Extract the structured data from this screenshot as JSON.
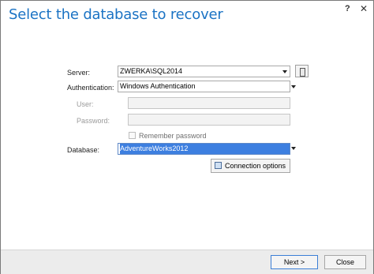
{
  "dialog": {
    "title": "Select the database to recover",
    "help_label": "?",
    "close_label": "✕"
  },
  "form": {
    "server_label": "Server:",
    "server_value": "ZWERKA\\SQL2014",
    "auth_label": "Authentication:",
    "auth_value": "Windows Authentication",
    "user_label": "User:",
    "user_value": "",
    "password_label": "Password:",
    "password_value": "",
    "remember_label": "Remember password",
    "database_label": "Database:",
    "database_value": "AdventureWorks2012",
    "connection_options_label": "Connection options"
  },
  "footer": {
    "next_label": "Next >",
    "close_label": "Close"
  },
  "icons": {
    "browse_server": "server-browse-icon",
    "connection_options": "connection-options-icon",
    "dropdown": "chevron-down-icon"
  },
  "colors": {
    "title": "#1b73c4",
    "selection": "#3d7fe0",
    "primary_border": "#3c7fd6"
  }
}
